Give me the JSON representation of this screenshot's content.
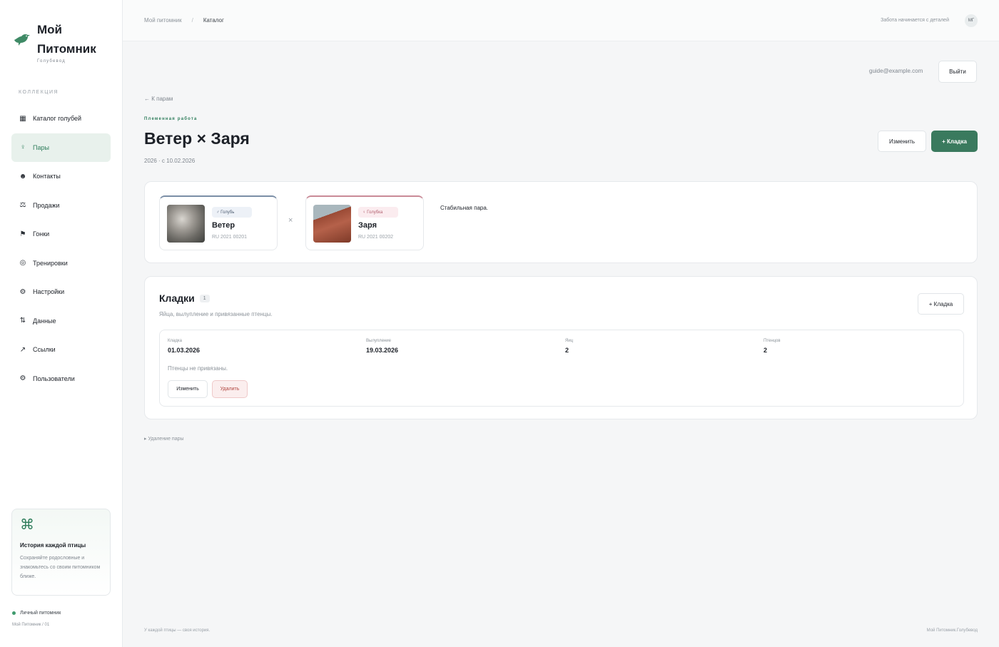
{
  "brand": {
    "title_line1": "Мой",
    "title_line2": "Питомник",
    "subtitle": "Голубевод"
  },
  "sidebar": {
    "section_label": "КОЛЛЕКЦИЯ",
    "items": [
      {
        "label": "Каталог голубей",
        "icon": "grid-icon"
      },
      {
        "label": "Пары",
        "icon": "pin-icon",
        "active": true
      },
      {
        "label": "Контакты",
        "icon": "contacts-icon"
      },
      {
        "label": "Продажи",
        "icon": "scales-icon"
      },
      {
        "label": "Гонки",
        "icon": "flag-icon"
      },
      {
        "label": "Тренировки",
        "icon": "target-icon"
      },
      {
        "label": "Настройки",
        "icon": "gear-icon"
      },
      {
        "label": "Данные",
        "icon": "sort-arrows-icon"
      },
      {
        "label": "Ссылки",
        "icon": "link-arrow-icon"
      },
      {
        "label": "Пользователи",
        "icon": "users-icon"
      }
    ],
    "promo": {
      "icon": "command-icon",
      "title": "История каждой птицы",
      "text": "Сохраняйте родословные и знакомьтесь со своим питомником ближе."
    },
    "status": "Личный питомник",
    "version": "Мой Питомник / 01"
  },
  "topbar": {
    "breadcrumbs": [
      "Мой питомник",
      "Каталог"
    ],
    "separator": "/",
    "tagline": "Забота начинается с деталей",
    "avatar_initials": "МГ"
  },
  "account": {
    "email": "guide@example.com",
    "logout_label": "Выйти"
  },
  "page": {
    "back_label": "← К парам",
    "eyebrow": "Племенная работа",
    "title": "Ветер × Заря",
    "subtitle": "2026 · с 10.02.2026",
    "edit_label": "Изменить",
    "add_clutch_label": "+ Кладка"
  },
  "pair": {
    "male": {
      "badge": "♂ Голубь",
      "name": "Ветер",
      "ring": "RU 2021 00201"
    },
    "female": {
      "badge": "♀ Голубка",
      "name": "Заря",
      "ring": "RU 2021 00202"
    },
    "cross": "×",
    "note": "Стабильная пара."
  },
  "clutches": {
    "title": "Кладки",
    "count": "1",
    "subtitle": "Яйца, вылупление и привязанные птенцы.",
    "add_label": "+ Кладка",
    "items": [
      {
        "fields": [
          {
            "label": "Кладка",
            "value": "01.03.2026"
          },
          {
            "label": "Вылупление",
            "value": "19.03.2026"
          },
          {
            "label": "Яиц",
            "value": "2"
          },
          {
            "label": "Птенцов",
            "value": "2"
          }
        ],
        "no_chicks": "Птенцы не привязаны.",
        "edit_label": "Изменить",
        "delete_label": "Удалить"
      }
    ]
  },
  "delete_pair_label": "▸ Удаление пары",
  "footer": {
    "left": "У каждой птицы — своя история.",
    "right": "Мой Питомник.Голубевод"
  },
  "colors": {
    "accent": "#3a7a5e",
    "male": "#7b8ea6",
    "female": "#c98a97",
    "danger": "#b0453f"
  }
}
